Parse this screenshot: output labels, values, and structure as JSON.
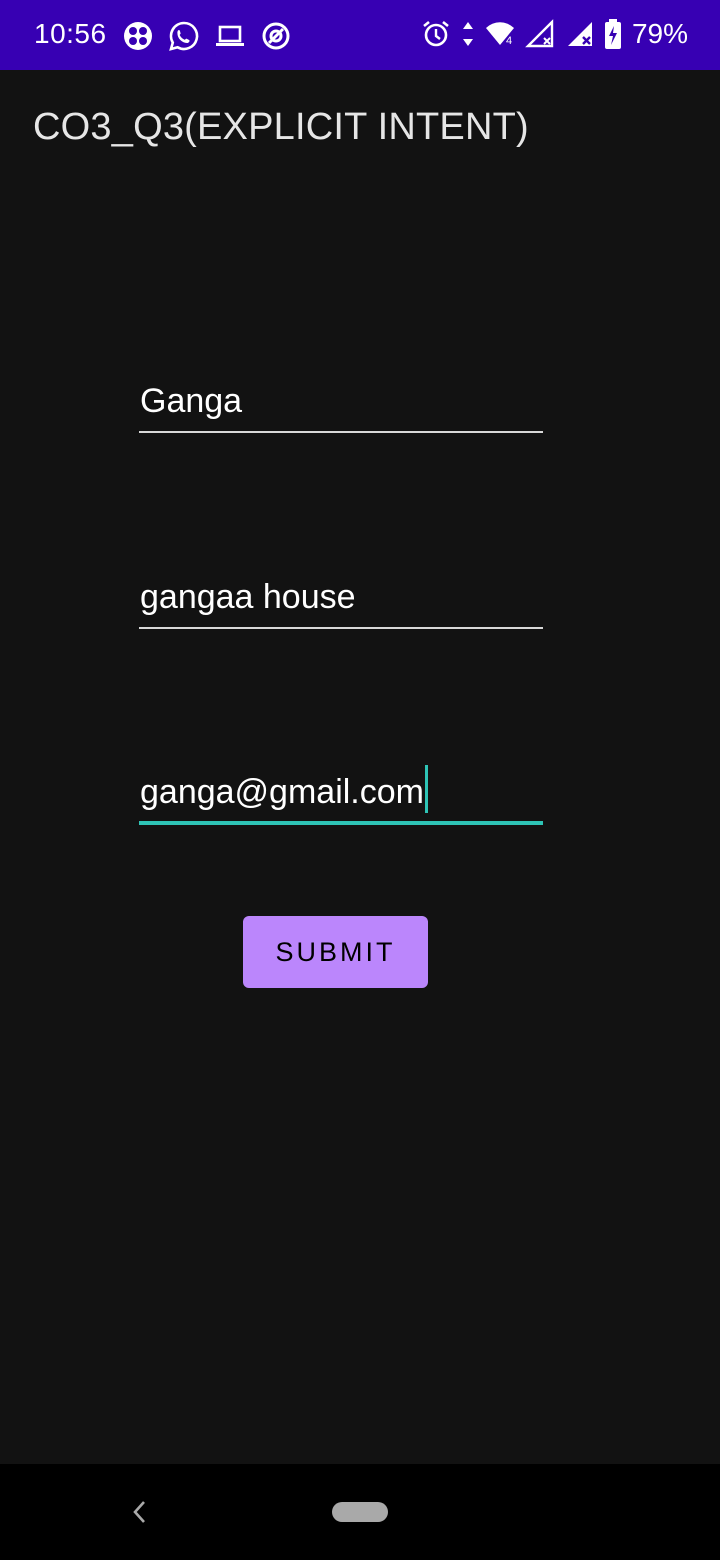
{
  "status_bar": {
    "time": "10:56",
    "battery_percent": "79%",
    "left_icons": [
      "grid-app-icon",
      "whatsapp-icon",
      "laptop-icon",
      "vpn-icon"
    ],
    "right_icons": [
      "alarm-icon",
      "data-arrows-icon",
      "wifi-icon",
      "signal-icon",
      "signal-2-icon",
      "battery-charging-icon"
    ],
    "background": "#3700b3"
  },
  "toolbar": {
    "title": "CO3_Q3(EXPLICIT INTENT)"
  },
  "form": {
    "name_value": "Ganga",
    "address_value": "gangaa house",
    "email_value": "ganga@gmail.com",
    "submit_label": "SUBMIT",
    "accent_color": "#2ec4b6",
    "button_color": "#bb86fc"
  },
  "nav_bar": {
    "icons": [
      "back-icon",
      "home-pill-icon"
    ]
  }
}
